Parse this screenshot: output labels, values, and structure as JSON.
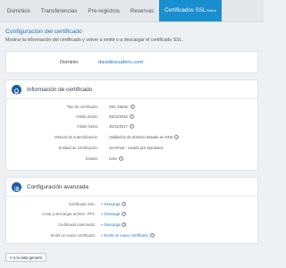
{
  "tabs": [
    {
      "label": "Dominios"
    },
    {
      "label": "Transferencias"
    },
    {
      "label": "Pre-registros"
    },
    {
      "label": "Reservas"
    },
    {
      "label": "Certificados SSL",
      "badge": "Nuevo"
    }
  ],
  "header": {
    "title": "Configuración del certificado",
    "description": "Mostrar la información del certificado y volver a emitir o a descargar el certificado SSL."
  },
  "domain": {
    "label": "Dominio",
    "value": "davidescudero.com"
  },
  "info": {
    "title": "Información de certificado",
    "rows": [
      {
        "label": "Tipo de certificado:",
        "value": "SSL Starter",
        "help": true
      },
      {
        "label": "Válido desde:",
        "value": "29/11/2016",
        "help": true
      },
      {
        "label": "Válido hasta:",
        "value": "30/11/2017",
        "help": true
      },
      {
        "label": "Método de autentificación:",
        "value": "Validación de dominio basada en DNS",
        "help": true
      },
      {
        "label": "Entidad de certificación:",
        "value": "GeoTrust - creado por Symantec",
        "help": false
      },
      {
        "label": "Estado:",
        "value": "Listo",
        "help": true
      }
    ]
  },
  "advanced": {
    "title": "Configuración avanzada",
    "rows": [
      {
        "label": "Certificado SSL:",
        "link": "» Descarga",
        "help": true
      },
      {
        "label": "Crear y descargar archivo .PFX:",
        "link": "» Descarga",
        "help": true
      },
      {
        "label": "Certificado intermedio:",
        "link": "» Descarga",
        "help": true
      },
      {
        "label": "Emitir un nuevo certificado:",
        "link": "» Emitir un nuevo certificado",
        "help": true
      }
    ]
  },
  "back_button": "Ir a la vista general",
  "colors": {
    "accent": "#1a8fd0",
    "link": "#1a75b8",
    "icon": "#1d5f9c"
  }
}
